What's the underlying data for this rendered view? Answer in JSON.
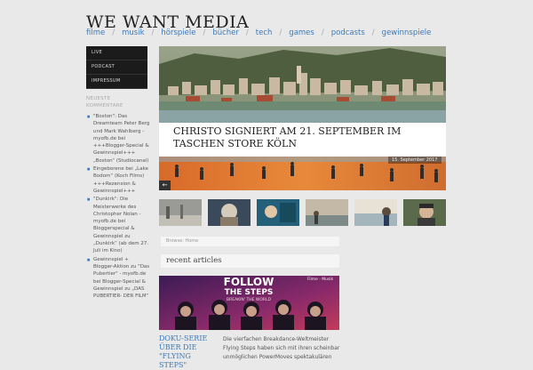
{
  "site": {
    "title": "WE WANT MEDIA"
  },
  "nav": {
    "items": [
      "filme",
      "musik",
      "hörspiele",
      "bücher",
      "tech",
      "games",
      "podcasts",
      "gewinnspiele"
    ],
    "separator": "/"
  },
  "sidebar": {
    "menu": [
      "LIVE",
      "PODCAST",
      "IMPRESSUM"
    ],
    "recent_comments_title": "NEUESTE KOMMENTARE",
    "comments": [
      "\"Boston\": Das Dreamteam Peter Berg und Mark Wahlberg - myofb.de bei +++Blogger-Special & Gewinnspiel+++ „Boston“ (Studiocanal)",
      "Eingeborene bei „Lake Bodom“ (Koch Films) +++Rezension & Gewinnspiel+++",
      "\"Dunkirk\": Die Meisterwerke des Christopher Nolan - myofb.de bei Bloggerspecial & Gewinnspiel zu „Dunkirk“ (ab dem 27. Juli im Kino)",
      "Gewinnspiel + Blogger-Aktion zu \"Das Pubertier\" - myofb.de bei Blogger-Special & Gewinnspiel zu „DAS PUBERTIER- DER FILM“"
    ]
  },
  "hero": {
    "headline": "CHRISTO SIGNIERT AM 21. SEPTEMBER IM TASCHEN STORE KÖLN",
    "date": "15. September 2017",
    "prev_icon": "arrow-left-icon",
    "prev_symbol": "←"
  },
  "thumbs": [
    "thumb-1",
    "thumb-2",
    "thumb-3",
    "thumb-4",
    "thumb-5",
    "thumb-6"
  ],
  "breadcrumb": "Browse: Home",
  "recent": {
    "title": "recent articles",
    "poster": {
      "text_top": "FOLLOW",
      "text_bottom": "THE STEPS",
      "subtitle": "BREAKIN' THE WORLD"
    },
    "tags": "Filme · Musik",
    "article_title": "DOKU-SERIE ÜBER DIE \"FLYING STEPS\"",
    "excerpt": "Die vierfachen Breakdance-Weltmeister Flying Steps haben sich mit ihren scheinbar unmöglichen PowerMoves spektakulären"
  },
  "colors": {
    "link": "#3a7ab8",
    "sidebar_bg": "#1b1b1b",
    "page_bg": "#e9e9e9"
  }
}
